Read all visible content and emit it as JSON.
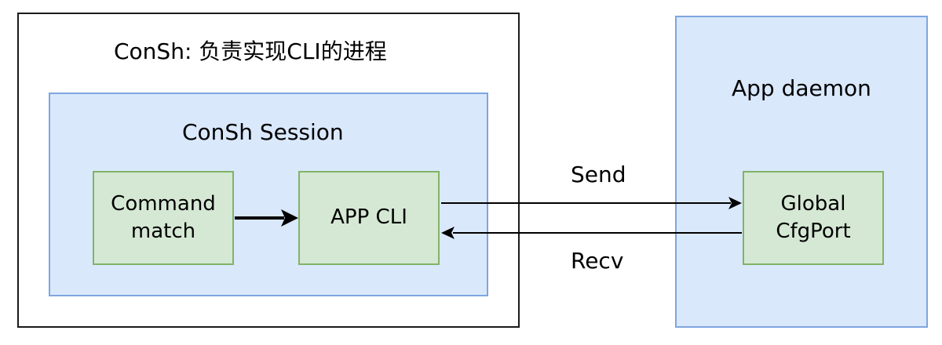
{
  "conSh": {
    "title": "ConSh: 负责实现CLI的进程"
  },
  "session": {
    "title": "ConSh Session",
    "command_match": "Command\nmatch",
    "app_cli": "APP CLI"
  },
  "daemon": {
    "title": "App daemon",
    "global_cfgport": "Global\nCfgPort"
  },
  "edges": {
    "send": "Send",
    "recv": "Recv"
  },
  "colors": {
    "blue_fill": "#dae8fc",
    "blue_stroke": "#7ea6e0",
    "green_fill": "#d5e8d4",
    "green_stroke": "#82b366"
  }
}
